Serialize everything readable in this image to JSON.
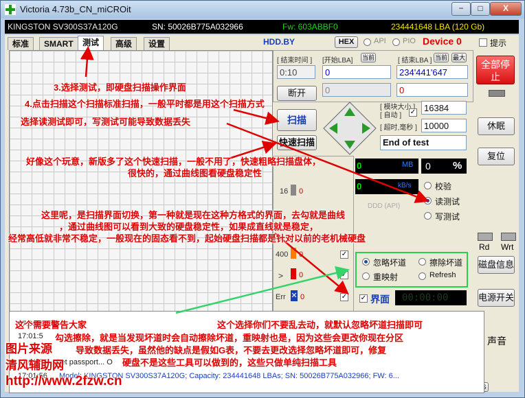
{
  "window": {
    "title": "Victoria 4.73b_CN_miCROit",
    "min_label": "−",
    "max_label": "□",
    "close_label": "X"
  },
  "info": {
    "model": "KINGSTON SV300S37A120G",
    "sn": "SN: 50026B775A032966",
    "fw": "Fw: 603ABBF0",
    "lba": "234441648 LBA (120 Gb)"
  },
  "tabs": [
    "标准",
    "SMART",
    "测试",
    "高级",
    "设置"
  ],
  "topbar": {
    "hdd": "HDD.BY",
    "hex": "HEX",
    "api": "API",
    "pio": "PIO",
    "device": "Device 0",
    "hint": "提示"
  },
  "lba_panel": {
    "end_time_label": "[ 结束时间 ]",
    "start_lba_label": "[开始LBA]",
    "cur_label": "当前",
    "end_lba_label": "[ 结束LBA ]",
    "cur2_label": "当前",
    "max_label": "最大",
    "time_value": "0:10",
    "start_value": "0",
    "end_value": "234'441'647",
    "second_value": "0"
  },
  "controls": {
    "stop_btn": "断开",
    "scan_btn": "扫描",
    "quick_btn": "快速扫描",
    "block_size_label": "[ 模块大小 ]",
    "auto_label": "[ 自动 ]",
    "block_size": "16384",
    "timeout_label": "[ 超时,毫秒 ]",
    "timeout": "10000",
    "end_mode": "End of test"
  },
  "speed": {
    "mb_value": "0",
    "mb_unit": "MB",
    "pct_value": "0",
    "pct_unit": "%",
    "kbs_value": "0",
    "kbs_unit": "kB/s"
  },
  "read_mode": {
    "verify": "校验",
    "read": "读测试",
    "write": "写测试",
    "ddd": "DDD (API)"
  },
  "counters": {
    "v16": "16",
    "v400": "400",
    "gt": ">",
    "err": "Err",
    "err_value": "0",
    "v16_value": "0",
    "v400_value": "0",
    "gt_value": "0"
  },
  "error_mode": {
    "ignore": "忽略坏道",
    "erase": "擦除坏道",
    "remap": "重映射",
    "refresh": "Refresh"
  },
  "grid_label": "界面",
  "timer": "00:00:00",
  "side": {
    "stop_all": "全部停止",
    "sleep": "休眠",
    "reset": "复位",
    "rd": "Rd",
    "wrt": "Wrt",
    "disk_info": "磁盘信息",
    "power": "电源开关",
    "sound": "声音",
    "cls": "CLS"
  },
  "log": {
    "line1_time": "17:01:5",
    "line2_time": "17:01:5",
    "line3_time": "17:01:56",
    "line3_text": "Get passport... O",
    "line4_time": "17:01:56",
    "line4_text": "Model: KINGSTON SV300S37A120G; Capacity: 234441648 LBAs; SN: 50026B775A032966; FW: 6..."
  },
  "annotations": {
    "a1": "3.选择测试，即硬盘扫描操作界面",
    "a2": "4.点击扫描这个扫描标准扫描，一般平时都是用这个扫描方式",
    "a3": "选择读测试即可，写测试可能导致数据丢失",
    "a4": "好像这个玩意，新版多了这个快速扫描，一般不用了，快速粗略扫描盘体，",
    "a5": "很快的，通过曲线图看硬盘稳定性",
    "a6": "这里呢，是扫描界面切换，第一种就是现在这种方格式的界面，去勾就是曲线",
    "a7": "，通过曲线图可以看到大致的硬盘稳定性，如果成直线就是稳定，",
    "a8": "经常高低就非常不稳定，一般现在的固态看不到，起始硬盘扫描都是针对以前的老机械硬盘",
    "a9": "这个需要警告大家",
    "a10": "这个选择你们不要乱去动，就默认忽略坏道扫描即可",
    "a11": "勾选擦除，就是当发现坏道时会自动擦除坏道，重映射也是，因为这些会更改你现在分区",
    "a12": "导致数据丢失，虽然他的缺点是假如G表，不要去更改选择忽略坏道即可，修复",
    "a13": "硬盘不是这些工具可以做到的，这些只做单纯扫描工具"
  },
  "watermark": {
    "w1": "图片来源",
    "w2": "清风辅助网",
    "w3": "http://www.2fzw.cn"
  },
  "colors": {
    "model": "#e8e8e8",
    "sn": "#ffffff",
    "fw": "#21d11a",
    "lba": "#f2e400",
    "device": "#e00000",
    "annotation": "#e00000",
    "green_led": "#00e000"
  }
}
